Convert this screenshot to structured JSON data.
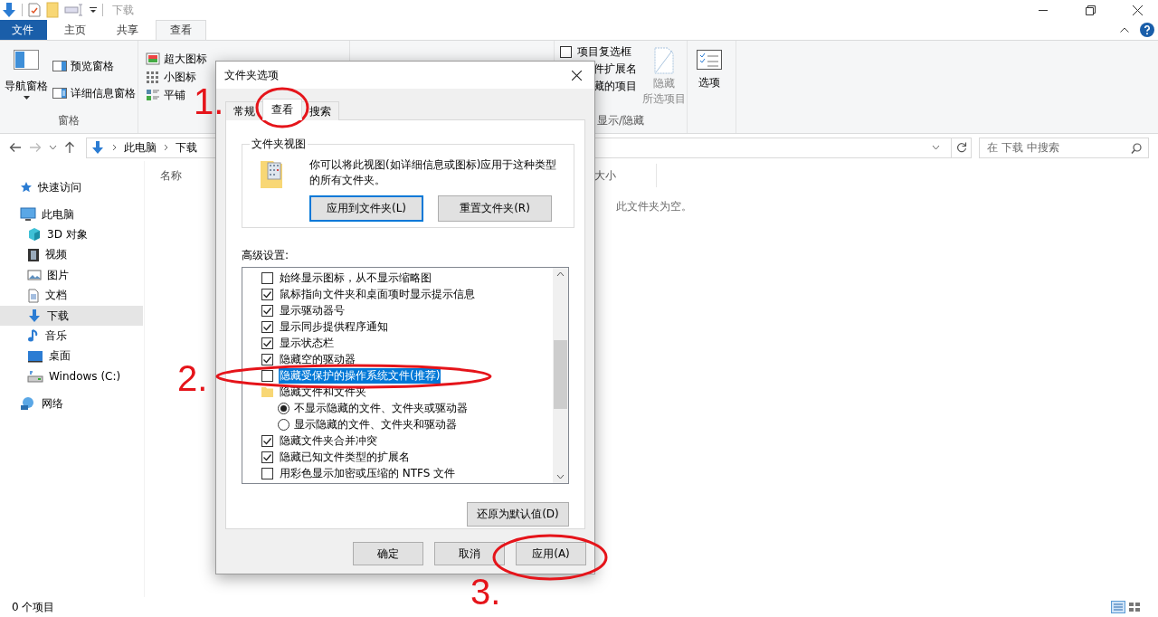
{
  "window": {
    "title": "下载"
  },
  "ribbon": {
    "tabs": [
      {
        "label": "文件",
        "kind": "file",
        "selected": false
      },
      {
        "label": "主页",
        "kind": "tab",
        "selected": false
      },
      {
        "label": "共享",
        "kind": "tab",
        "selected": false
      },
      {
        "label": "查看",
        "kind": "tab",
        "selected": true
      }
    ],
    "panes": {
      "label": "窗格",
      "nav": "导航窗格",
      "items": [
        "预览窗格",
        "详细信息窗格"
      ]
    },
    "layout": {
      "rows": [
        [
          "超大图标"
        ],
        [
          "小图标"
        ],
        [
          "平铺"
        ]
      ]
    },
    "show_hide": {
      "label": "显示/隐藏",
      "items": [
        {
          "label": "项目复选框",
          "kind": "checkbox",
          "checked": false
        },
        {
          "label": "件扩展名",
          "kind": "partial"
        },
        {
          "label": "藏的项目",
          "kind": "partial"
        }
      ],
      "hide_button": {
        "lines": [
          "隐藏",
          "所选项目"
        ],
        "disabled": true
      }
    },
    "options": {
      "label": "选项"
    }
  },
  "address": {
    "path": [
      "此电脑",
      "下载"
    ],
    "search_placeholder": "在 下载 中搜索"
  },
  "sidebar": {
    "items": [
      {
        "label": "快速访问",
        "kind": "star",
        "selected": false
      },
      {
        "label": "此电脑",
        "kind": "pc",
        "selected": false,
        "children": [
          {
            "label": "3D 对象",
            "kind": "cube",
            "selected": false
          },
          {
            "label": "视频",
            "kind": "film",
            "selected": false
          },
          {
            "label": "图片",
            "kind": "image",
            "selected": false
          },
          {
            "label": "文档",
            "kind": "doc",
            "selected": false
          },
          {
            "label": "下载",
            "kind": "download",
            "selected": true
          },
          {
            "label": "音乐",
            "kind": "music",
            "selected": false
          },
          {
            "label": "桌面",
            "kind": "desktop",
            "selected": false
          },
          {
            "label": "Windows (C:)",
            "kind": "drive",
            "selected": false
          }
        ]
      },
      {
        "label": "网络",
        "kind": "network",
        "selected": false
      }
    ]
  },
  "content": {
    "columns": [
      "名称",
      "大小"
    ],
    "empty_message": "此文件夹为空。"
  },
  "status_bar": {
    "text": "0 个项目"
  },
  "dialog": {
    "title": "文件夹选项",
    "tabs": [
      {
        "label": "常规",
        "selected": false
      },
      {
        "label": "查看",
        "selected": true
      },
      {
        "label": "搜索",
        "selected": false
      }
    ],
    "folder_views": {
      "legend": "文件夹视图",
      "text": "你可以将此视图(如详细信息或图标)应用于这种类型的所有文件夹。",
      "buttons": [
        {
          "label": "应用到文件夹(L)",
          "focused": true
        },
        {
          "label": "重置文件夹(R)",
          "focused": false
        }
      ]
    },
    "advanced": {
      "label": "高级设置:",
      "items": [
        {
          "label": "始终显示图标，从不显示缩略图",
          "kind": "checkbox",
          "checked": false,
          "selected": false
        },
        {
          "label": "鼠标指向文件夹和桌面项时显示提示信息",
          "kind": "checkbox",
          "checked": true,
          "selected": false
        },
        {
          "label": "显示驱动器号",
          "kind": "checkbox",
          "checked": true,
          "selected": false
        },
        {
          "label": "显示同步提供程序通知",
          "kind": "checkbox",
          "checked": true,
          "selected": false
        },
        {
          "label": "显示状态栏",
          "kind": "checkbox",
          "checked": true,
          "selected": false
        },
        {
          "label": "隐藏空的驱动器",
          "kind": "checkbox",
          "checked": true,
          "selected": false
        },
        {
          "label": "隐藏受保护的操作系统文件(推荐)",
          "kind": "checkbox",
          "checked": false,
          "selected": true
        },
        {
          "label": "隐藏文件和文件夹",
          "kind": "folder",
          "selected": false,
          "children": [
            {
              "label": "不显示隐藏的文件、文件夹或驱动器",
              "kind": "radio",
              "checked": true
            },
            {
              "label": "显示隐藏的文件、文件夹和驱动器",
              "kind": "radio",
              "checked": false
            }
          ]
        },
        {
          "label": "隐藏文件夹合并冲突",
          "kind": "checkbox",
          "checked": true,
          "selected": false
        },
        {
          "label": "隐藏已知文件类型的扩展名",
          "kind": "checkbox",
          "checked": true,
          "selected": false
        },
        {
          "label": "用彩色显示加密或压缩的 NTFS 文件",
          "kind": "checkbox",
          "checked": false,
          "selected": false
        }
      ]
    },
    "restore_button": "还原为默认值(D)",
    "buttons": [
      "确定",
      "取消",
      "应用(A)"
    ]
  },
  "annotations": [
    {
      "label": "1."
    },
    {
      "label": "2."
    },
    {
      "label": "3."
    }
  ]
}
